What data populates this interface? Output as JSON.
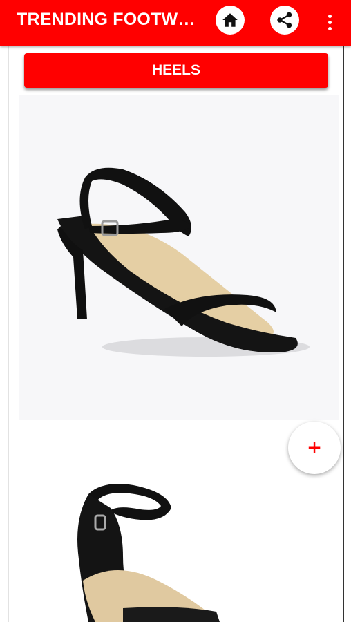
{
  "app": {
    "title": "TRENDING FOOTWEAR"
  },
  "toolbar": {
    "home_icon": "home-icon",
    "share_icon": "share-icon",
    "more_icon": "more-vert-icon"
  },
  "category": {
    "label": "HEELS"
  },
  "products": [
    {
      "image": "black-strappy-heel-sandal"
    },
    {
      "image": "black-ankle-strap-block-heel"
    }
  ],
  "fab": {
    "label": "+"
  },
  "colors": {
    "accent": "#ff0000",
    "background": "#ffffff"
  }
}
